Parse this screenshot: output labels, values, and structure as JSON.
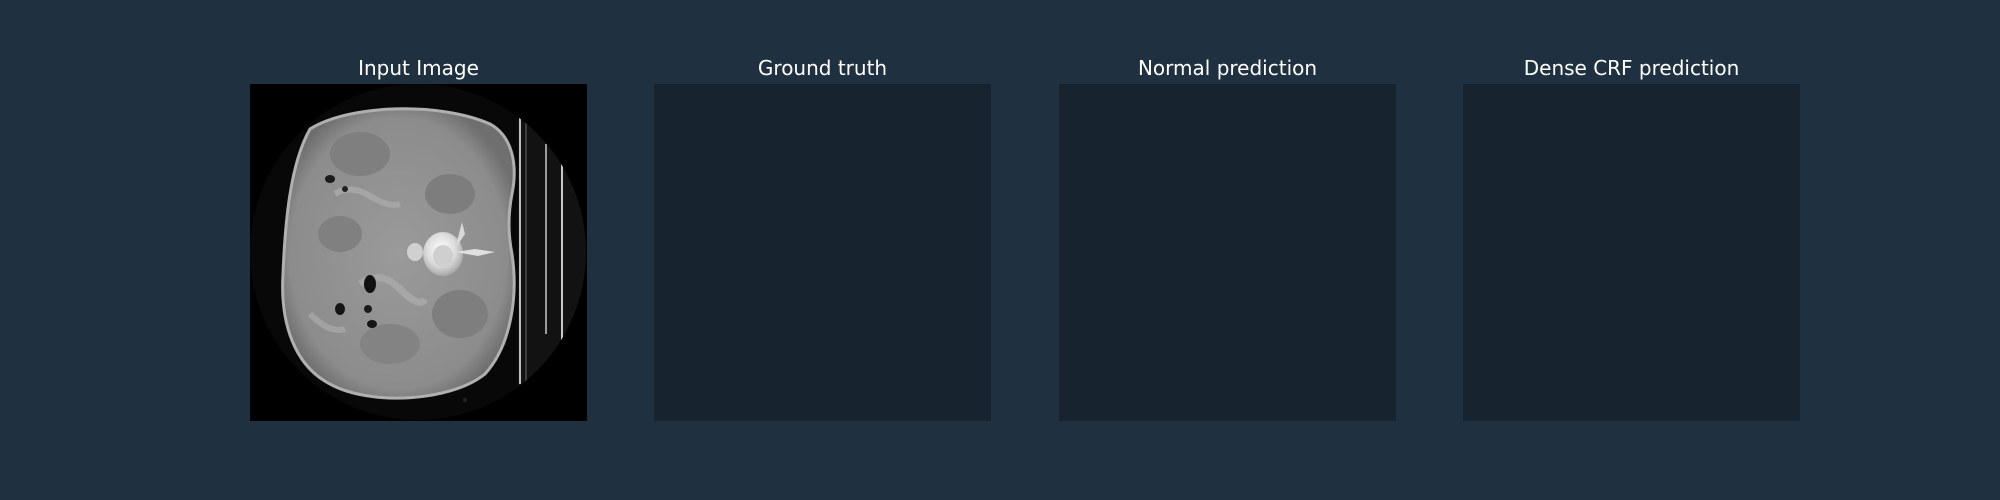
{
  "panels": [
    {
      "title": "Input Image",
      "content": "ct-scan"
    },
    {
      "title": "Ground truth",
      "content": "empty"
    },
    {
      "title": "Normal prediction",
      "content": "empty"
    },
    {
      "title": "Dense CRF prediction",
      "content": "empty"
    }
  ],
  "colors": {
    "background": "#1f3040",
    "empty_panel": "#172430",
    "title_text": "#ffffff",
    "scan_background": "#000000"
  }
}
